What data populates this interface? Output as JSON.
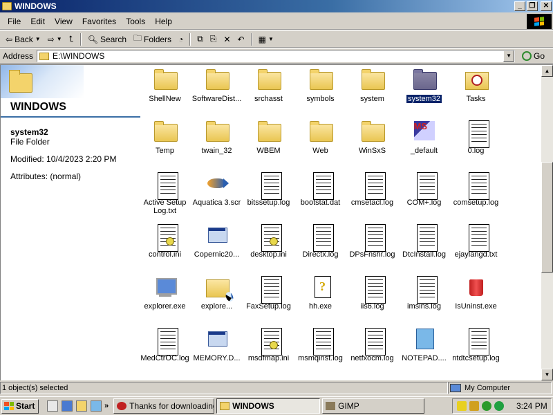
{
  "window": {
    "title": "WINDOWS"
  },
  "menu": [
    "File",
    "Edit",
    "View",
    "Favorites",
    "Tools",
    "Help"
  ],
  "toolbar": {
    "back": "Back",
    "search": "Search",
    "folders": "Folders"
  },
  "address": {
    "label": "Address",
    "value": "E:\\WINDOWS",
    "go": "Go"
  },
  "left_pane": {
    "folder_title": "WINDOWS",
    "selected_name": "system32",
    "selected_type": "File Folder",
    "modified": "Modified: 10/4/2023 2:20 PM",
    "attributes": "Attributes: (normal)"
  },
  "files": [
    {
      "label": "ShellNew",
      "icon": "folder-icon"
    },
    {
      "label": "SoftwareDist...",
      "icon": "folder-icon"
    },
    {
      "label": "srchasst",
      "icon": "folder-icon"
    },
    {
      "label": "symbols",
      "icon": "folder-icon"
    },
    {
      "label": "system",
      "icon": "folder-icon"
    },
    {
      "label": "system32",
      "icon": "folder-icon",
      "selected": true
    },
    {
      "label": "Tasks",
      "icon": "tasks-folder-icon"
    },
    {
      "label": "Temp",
      "icon": "folder-icon"
    },
    {
      "label": "twain_32",
      "icon": "folder-icon"
    },
    {
      "label": "WBEM",
      "icon": "folder-icon"
    },
    {
      "label": "Web",
      "icon": "folder-icon"
    },
    {
      "label": "WinSxS",
      "icon": "folder-icon"
    },
    {
      "label": "_default",
      "icon": "ms-dos-icon"
    },
    {
      "label": "0.log",
      "icon": "text-file-icon"
    },
    {
      "label": "Active Setup Log.txt",
      "icon": "text-file-icon"
    },
    {
      "label": "Aquatica 3.scr",
      "icon": "fish-screensaver-icon"
    },
    {
      "label": "bitssetup.log",
      "icon": "text-file-icon"
    },
    {
      "label": "bootstat.dat",
      "icon": "dat-file-icon"
    },
    {
      "label": "cmsetacl.log",
      "icon": "text-file-icon"
    },
    {
      "label": "COM+.log",
      "icon": "text-file-icon"
    },
    {
      "label": "comsetup.log",
      "icon": "text-file-icon"
    },
    {
      "label": "control.ini",
      "icon": "ini-file-icon"
    },
    {
      "label": "Copernic20...",
      "icon": "installer-icon"
    },
    {
      "label": "desktop.ini",
      "icon": "ini-file-icon"
    },
    {
      "label": "Directx.log",
      "icon": "text-file-icon"
    },
    {
      "label": "DPsFnshr.log",
      "icon": "text-file-icon"
    },
    {
      "label": "DtcInstall.log",
      "icon": "text-file-icon"
    },
    {
      "label": "ejaylangd.txt",
      "icon": "text-file-icon"
    },
    {
      "label": "explorer.exe",
      "icon": "computer-icon"
    },
    {
      "label": "explore...",
      "icon": "search-folder-icon"
    },
    {
      "label": "FaxSetup.log",
      "icon": "text-file-icon"
    },
    {
      "label": "hh.exe",
      "icon": "help-icon"
    },
    {
      "label": "iis6.log",
      "icon": "text-file-icon"
    },
    {
      "label": "imsins.log",
      "icon": "text-file-icon"
    },
    {
      "label": "IsUninst.exe",
      "icon": "uninstall-icon"
    },
    {
      "label": "MedCtrOC.log",
      "icon": "text-file-icon"
    },
    {
      "label": "MEMORY.D...",
      "icon": "memory-dump-icon"
    },
    {
      "label": "msdfmap.ini",
      "icon": "ini-file-icon"
    },
    {
      "label": "msmqinst.log",
      "icon": "text-file-icon"
    },
    {
      "label": "netfxocm.log",
      "icon": "text-file-icon"
    },
    {
      "label": "NOTEPAD....",
      "icon": "notepad-icon"
    },
    {
      "label": "ntdtcsetup.log",
      "icon": "text-file-icon"
    }
  ],
  "status": {
    "left": "1 object(s) selected",
    "right": "My Computer"
  },
  "taskbar": {
    "start": "Start",
    "tasks": [
      {
        "label": "Thanks for downloading ...",
        "active": false
      },
      {
        "label": "WINDOWS",
        "active": true
      },
      {
        "label": "GIMP",
        "active": false
      }
    ],
    "clock": "3:24 PM"
  }
}
